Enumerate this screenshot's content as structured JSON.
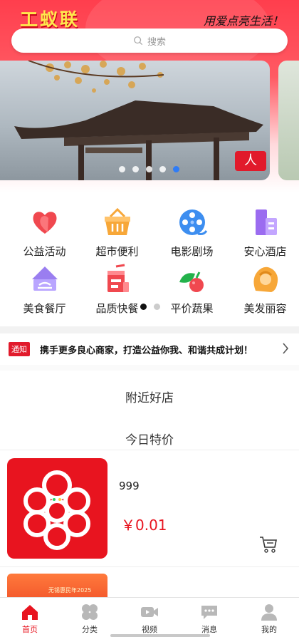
{
  "app": {
    "title": "工蚁联",
    "slogan": "用爱点亮生活！"
  },
  "search": {
    "placeholder": "搜索"
  },
  "banner": {
    "slide_count": 5,
    "active_slide": 5,
    "stamp_text": "人"
  },
  "categories": [
    {
      "label": "公益活动",
      "icon": "heart-icon",
      "color": "#f0484f"
    },
    {
      "label": "超市便利",
      "icon": "basket-icon",
      "color": "#f7a738"
    },
    {
      "label": "电影剧场",
      "icon": "film-reel-icon",
      "color": "#3d8ef0"
    },
    {
      "label": "安心酒店",
      "icon": "hotel-icon",
      "color": "#9b6cf0"
    },
    {
      "label": "美食餐厅",
      "icon": "food-cloche-icon",
      "color": "#9a7ef0"
    },
    {
      "label": "品质快餐",
      "icon": "drink-cup-icon",
      "color": "#f0484f"
    },
    {
      "label": "平价蔬果",
      "icon": "fruit-icon",
      "color": "#23b24b"
    },
    {
      "label": "美发丽容",
      "icon": "hair-icon",
      "color": "#f7a738"
    }
  ],
  "category_pager": {
    "pages": 2,
    "active": 1
  },
  "notice": {
    "tag": "通知",
    "text": "携手更多良心商家，打造公益你我、和谐共成计划！"
  },
  "sections": {
    "nearby": "附近好店",
    "today_special": "今日特价"
  },
  "products": [
    {
      "name": "999",
      "price": "￥0.01"
    },
    {
      "name": "",
      "price": "",
      "image_text": "无锡惠民年2025"
    }
  ],
  "tabbar": [
    {
      "label": "首页",
      "icon": "home-icon",
      "active": true
    },
    {
      "label": "分类",
      "icon": "category-icon",
      "active": false
    },
    {
      "label": "视频",
      "icon": "video-icon",
      "active": false
    },
    {
      "label": "消息",
      "icon": "message-icon",
      "active": false
    },
    {
      "label": "我的",
      "icon": "profile-icon",
      "active": false
    }
  ],
  "colors": {
    "brand_red": "#e8141f",
    "header_red": "#ff3e4d",
    "logo_yellow": "#ffe94d",
    "banner_dot_active": "#2f7cf6"
  }
}
